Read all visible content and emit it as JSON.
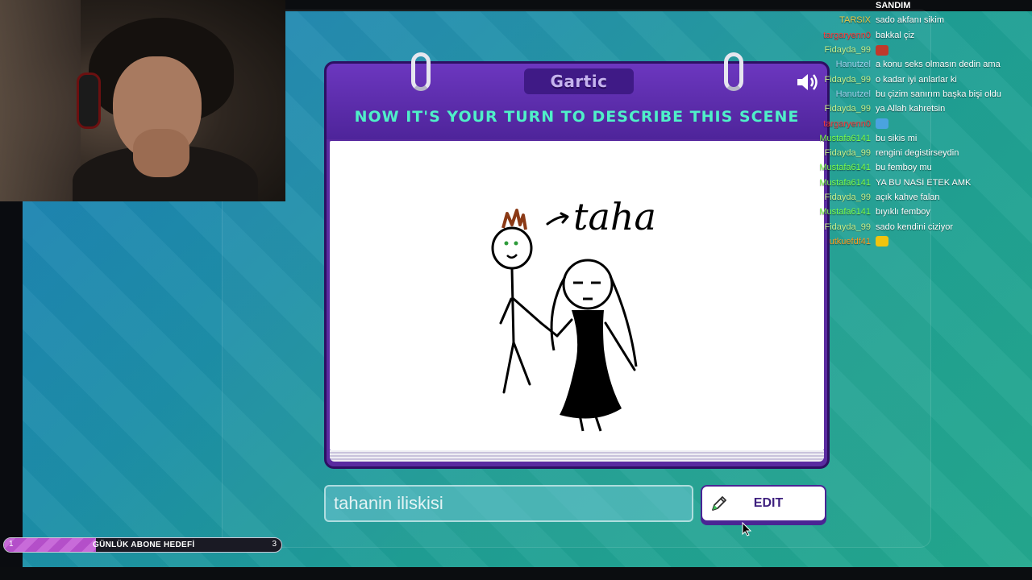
{
  "game": {
    "logo": "Gartic",
    "title": "NOW IT'S YOUR TURN TO DESCRIBE THIS SCENE",
    "drawing_label": "taha",
    "answer_value": "tahanin iliskisi",
    "edit_label": "EDIT"
  },
  "chat": {
    "messages": [
      {
        "user": "",
        "text": "SANDIM",
        "color": "#ffffff"
      },
      {
        "user": "TARSIX",
        "text": "sado akfanı sikim",
        "color": "#e8c84a"
      },
      {
        "user": "targaryenn0",
        "text": "bakkal çiz",
        "color": "#ff3b3b"
      },
      {
        "user": "Fidayda_99",
        "text": "",
        "color": "#c6f08c",
        "emote": "#c0392b"
      },
      {
        "user": "Hanutzel",
        "text": "a  konu seks olmasın dedin ama",
        "color": "#9fd4f0"
      },
      {
        "user": "Fidayda_99",
        "text": "o kadar iyi anlarlar ki",
        "color": "#c6f08c"
      },
      {
        "user": "Hanutzel",
        "text": "bu çizim sanırım başka bişi oldu",
        "color": "#9fd4f0"
      },
      {
        "user": "Fidayda_99",
        "text": "ya Allah kahretsin",
        "color": "#c6f08c"
      },
      {
        "user": "targaryenn0",
        "text": "",
        "color": "#ff3b3b",
        "emote": "#4aa3df"
      },
      {
        "user": "Mustafa6141",
        "text": "bu sikis mi",
        "color": "#7cff4a"
      },
      {
        "user": "Fidayda_99",
        "text": "rengini degistirseydin",
        "color": "#c6f08c"
      },
      {
        "user": "Mustafa6141",
        "text": "bu femboy mu",
        "color": "#7cff4a"
      },
      {
        "user": "Mustafa6141",
        "text": "YA BU NASİ ETEK AMK",
        "color": "#7cff4a"
      },
      {
        "user": "Fidayda_99",
        "text": "açık kahve falan",
        "color": "#c6f08c"
      },
      {
        "user": "Mustafa6141",
        "text": "bıyıklı femboy",
        "color": "#7cff4a"
      },
      {
        "user": "Fidayda_99",
        "text": "sado kendini ciziyor",
        "color": "#c6f08c"
      },
      {
        "user": "utkuefdf41",
        "text": "",
        "color": "#ff9a1f",
        "emote": "#f1c40f"
      }
    ]
  },
  "subgoal": {
    "start": "1",
    "label": "GÜNLÜK ABONE HEDEFİ",
    "end": "3",
    "progress": 0.33
  }
}
